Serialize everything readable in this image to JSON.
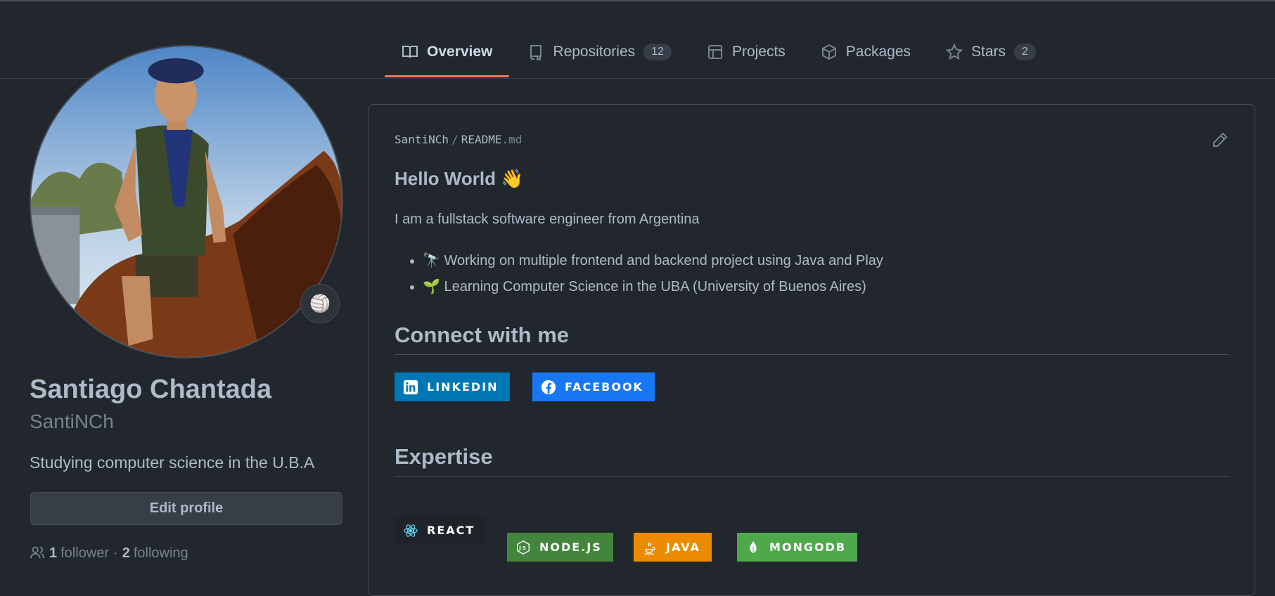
{
  "tabs": [
    {
      "label": "Overview",
      "icon": "book-icon",
      "active": true
    },
    {
      "label": "Repositories",
      "icon": "repo-icon",
      "count": "12"
    },
    {
      "label": "Projects",
      "icon": "table-icon"
    },
    {
      "label": "Packages",
      "icon": "package-icon"
    },
    {
      "label": "Stars",
      "icon": "star-icon",
      "count": "2"
    }
  ],
  "profile": {
    "status_emoji": "🏐",
    "fullname": "Santiago Chantada",
    "username": "SantiNCh",
    "bio": "Studying computer science in the U.B.A",
    "edit_label": "Edit profile",
    "followers_count": "1",
    "followers_label": "follower",
    "separator": "·",
    "following_count": "2",
    "following_label": "following"
  },
  "readme": {
    "owner": "SantiNCh",
    "slash": "/",
    "file": "README",
    "ext": ".md",
    "heading": "Hello World 👋",
    "intro": "I am a fullstack software engineer from Argentina",
    "bullets": [
      "🔭 Working on multiple frontend and backend project using Java and Play",
      "🌱 Learning Computer Science in the UBA (University of Buenos Aires)"
    ],
    "connect_heading": "Connect with me",
    "connect_badges": [
      {
        "label": "LINKEDIN",
        "color": "#0077b5",
        "icon": "linkedin-icon"
      },
      {
        "label": "FACEBOOK",
        "color": "#1877f2",
        "icon": "facebook-icon"
      }
    ],
    "expertise_heading": "Expertise",
    "expertise_badges": [
      {
        "label": "REACT",
        "color": "#20232a",
        "icon": "react-icon"
      },
      {
        "label": "NODE.JS",
        "color": "#43853d",
        "icon": "nodejs-icon"
      },
      {
        "label": "JAVA",
        "color": "#ed8b00",
        "icon": "java-icon"
      },
      {
        "label": "MONGODB",
        "color": "#4ea94b",
        "icon": "mongodb-icon"
      }
    ]
  },
  "colors": {
    "background": "#22272e",
    "accent": "#ec775c",
    "border": "#444c56"
  }
}
